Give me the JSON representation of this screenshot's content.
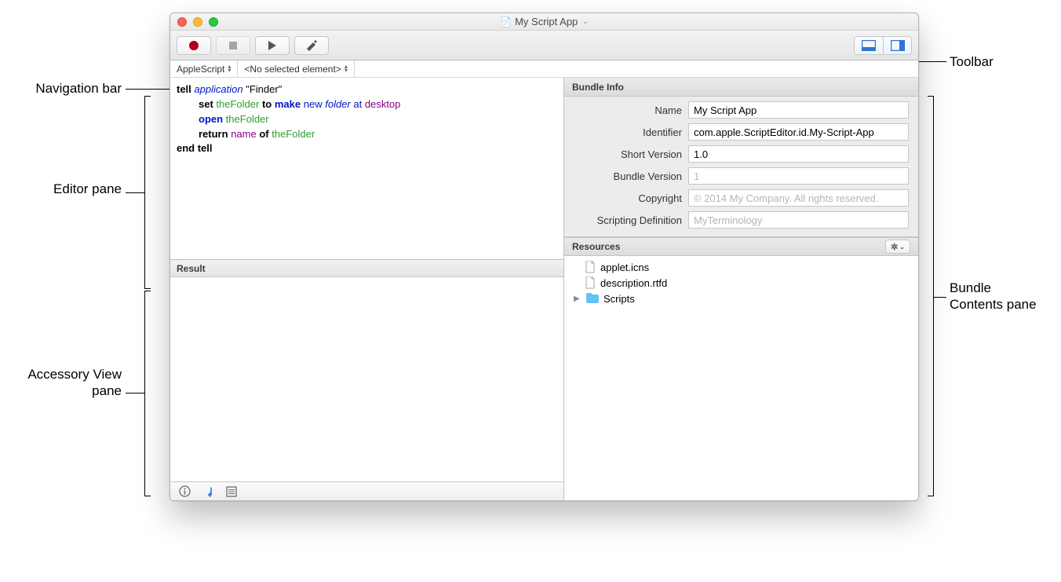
{
  "window": {
    "title": "My Script App"
  },
  "navbar": {
    "language": "AppleScript",
    "element": "<No selected element>"
  },
  "editor": {
    "line1_kw": "tell",
    "line1_cls": "application",
    "line1_str": "\"Finder\"",
    "line2_kw": "set",
    "line2_var": "theFolder",
    "line2_to": "to",
    "line2_cmd": "make",
    "line2_new": "new",
    "line2_class": "folder",
    "line2_at": "at",
    "line2_enum": "desktop",
    "line3_cmd": "open",
    "line3_var": "theFolder",
    "line4_kw": "return",
    "line4_prop": "name",
    "line4_of": "of",
    "line4_var": "theFolder",
    "line5": "end tell"
  },
  "result": {
    "header": "Result"
  },
  "bundle": {
    "header": "Bundle Info",
    "name_label": "Name",
    "name_value": "My Script App",
    "id_label": "Identifier",
    "id_value": "com.apple.ScriptEditor.id.My-Script-App",
    "shortver_label": "Short Version",
    "shortver_value": "1.0",
    "bundlever_label": "Bundle Version",
    "bundlever_value": "",
    "bundlever_placeholder": "1",
    "copyright_label": "Copyright",
    "copyright_value": "",
    "copyright_placeholder": "© 2014 My Company. All rights reserved.",
    "sdef_label": "Scripting Definition",
    "sdef_value": "",
    "sdef_placeholder": "MyTerminology"
  },
  "resources": {
    "header": "Resources",
    "items": [
      {
        "name": "applet.icns",
        "type": "file"
      },
      {
        "name": "description.rtfd",
        "type": "file"
      },
      {
        "name": "Scripts",
        "type": "folder"
      }
    ]
  },
  "callouts": {
    "nav": "Navigation bar",
    "editor": "Editor pane",
    "accessory": "Accessory View pane",
    "toolbar": "Toolbar",
    "bundle": "Bundle Contents pane"
  }
}
